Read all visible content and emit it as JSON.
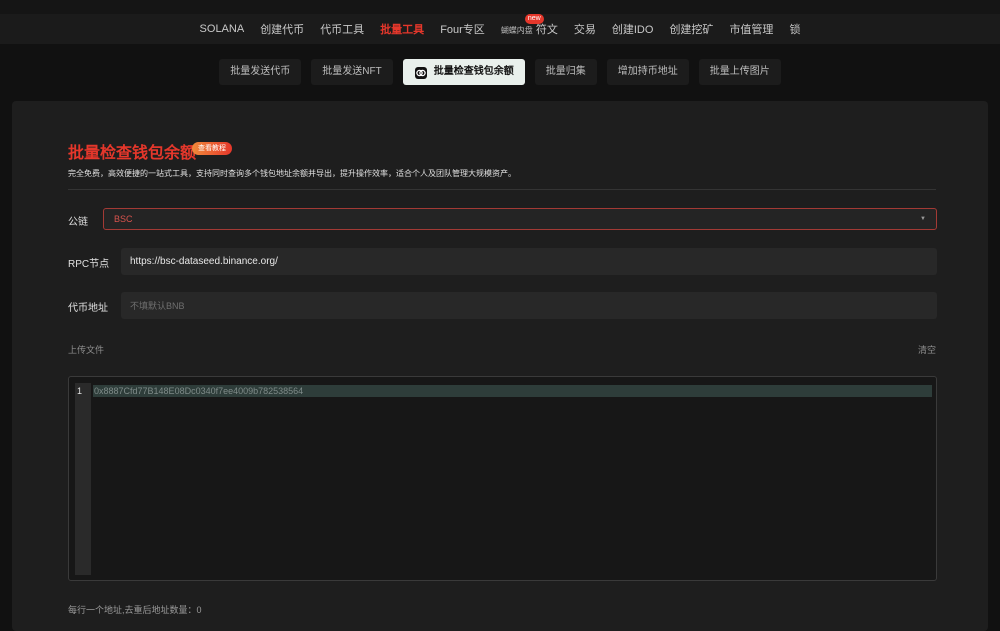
{
  "nav": {
    "items": [
      {
        "label": "SOLANA"
      },
      {
        "label": "创建代币"
      },
      {
        "label": "代币工具"
      },
      {
        "label": "批量工具",
        "active": true
      },
      {
        "label": "Four专区"
      },
      {
        "prefix": "蝴蝶内盘",
        "label": "符文",
        "badge": "new"
      },
      {
        "label": "交易"
      },
      {
        "label": "创建IDO"
      },
      {
        "label": "创建挖矿"
      },
      {
        "label": "市值管理"
      },
      {
        "label": "锁"
      }
    ]
  },
  "subnav": {
    "tabs": [
      {
        "label": "批量发送代币"
      },
      {
        "label": "批量发送NFT"
      },
      {
        "label": "批量检查钱包余额",
        "active": true,
        "icon": "wallet-icon"
      },
      {
        "label": "批量归集"
      },
      {
        "label": "增加持币地址"
      },
      {
        "label": "批量上传图片"
      }
    ]
  },
  "page": {
    "title": "批量检查钱包余额",
    "tutorial_badge": "查看教程",
    "description": "完全免费，高效便捷的一站式工具，支持同时查询多个钱包地址余额并导出，提升操作效率，适合个人及团队管理大规模资产。"
  },
  "form": {
    "chain_label": "公链",
    "chain_value": "BSC",
    "rpc_label": "RPC节点",
    "rpc_value": "https://bsc-dataseed.binance.org/",
    "token_label": "代币地址",
    "token_placeholder": "不填默认BNB",
    "upload_label": "上传文件",
    "clear_label": "清空"
  },
  "editor": {
    "line_number": "1",
    "line_text": "0x8887Cfd77B148E08Dc0340f7ee4009b782538564"
  },
  "footer": {
    "count_text": "每行一个地址,去重后地址数量：0"
  },
  "colors": {
    "accent": "#e5372b",
    "background": "#111111",
    "panel": "#1e1e1e"
  }
}
